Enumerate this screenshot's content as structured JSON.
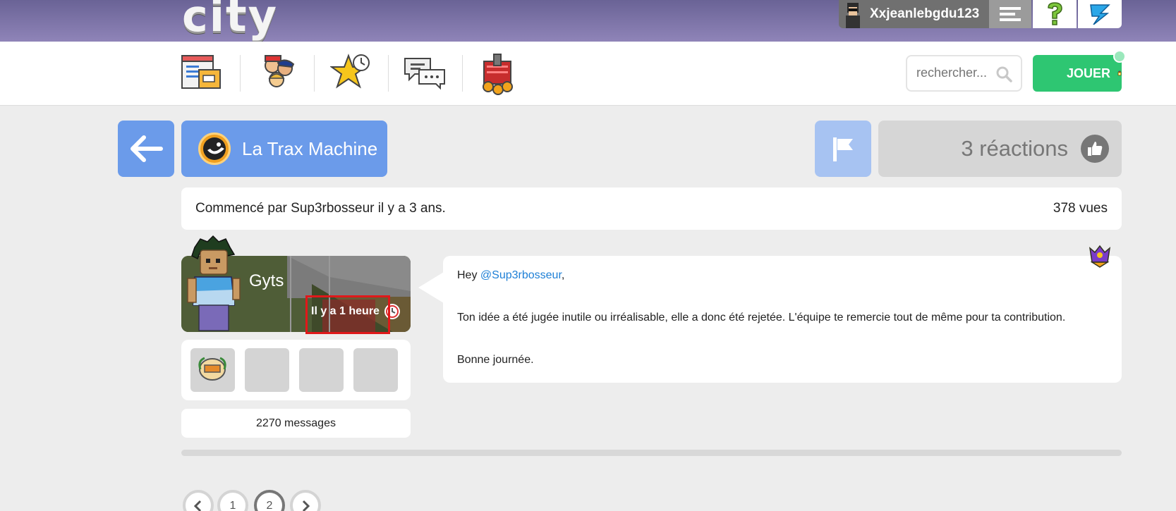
{
  "topbar": {
    "logo_text": "city",
    "username": "Xxjeanlebgdu123"
  },
  "nav": {
    "items": [
      {
        "icon": "news-icon"
      },
      {
        "icon": "community-icon"
      },
      {
        "icon": "favorites-icon"
      },
      {
        "icon": "forum-icon"
      },
      {
        "icon": "shop-icon"
      }
    ],
    "search_placeholder": "rechercher...",
    "play_label": "JOUER"
  },
  "topic": {
    "title": "La Trax Machine",
    "reactions_label": "3 réactions",
    "started_by": "Commencé par Sup3rbosseur il y a 3 ans.",
    "views": "378 vues"
  },
  "post": {
    "author": "Gyts",
    "time": "Il y a 1 heure",
    "messages_count": "2270 messages",
    "greeting_prefix": "Hey ",
    "mention": "@Sup3rbosseur",
    "greeting_suffix": ",",
    "body": "Ton idée a été jugée inutile ou irréalisable, elle a donc été rejetée. L'équipe te remercie tout de même pour ta contribution.",
    "closing": "Bonne journée."
  },
  "pagination": {
    "pages": [
      "1",
      "2"
    ],
    "current": "2"
  },
  "colors": {
    "accent_blue": "#6b9bea",
    "play_green": "#2ec672",
    "mention_blue": "#1d7fd6"
  }
}
